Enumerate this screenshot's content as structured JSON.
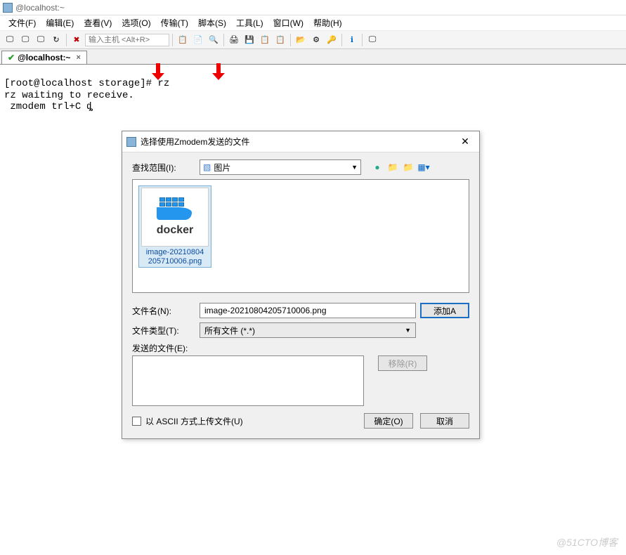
{
  "window": {
    "title": "@localhost:~"
  },
  "menu": {
    "file": "文件(F)",
    "edit": "编辑(E)",
    "view": "查看(V)",
    "options": "选项(O)",
    "transfer": "传输(T)",
    "script": "脚本(S)",
    "tools": "工具(L)",
    "window": "窗口(W)",
    "help": "帮助(H)"
  },
  "toolbar": {
    "host_placeholder": "输入主机 <Alt+R>"
  },
  "tab": {
    "label": "@localhost:~",
    "close": "×"
  },
  "terminal": {
    "line1": "[root@localhost storage]# rz",
    "line2": "rz waiting to receive.",
    "line3": " zmodem trl+C ȡ"
  },
  "dialog": {
    "title": "选择使用Zmodem发送的文件",
    "close": "✕",
    "lookin_label": "查找范围(I):",
    "lookin_value": "图片",
    "file": {
      "name_line1": "image-20210804",
      "name_line2": "205710006.png",
      "thumb_text": "docker"
    },
    "filename_label": "文件名(N):",
    "filename_value": "image-20210804205710006.png",
    "filetype_label": "文件类型(T):",
    "filetype_value": "所有文件 (*.*)",
    "sendfiles_label": "发送的文件(E):",
    "add_btn": "添加A",
    "remove_btn": "移除(R)",
    "ascii_label": "以 ASCII 方式上传文件(U)",
    "ok_btn": "确定(O)",
    "cancel_btn": "取消"
  },
  "watermark": "@51CTO博客"
}
